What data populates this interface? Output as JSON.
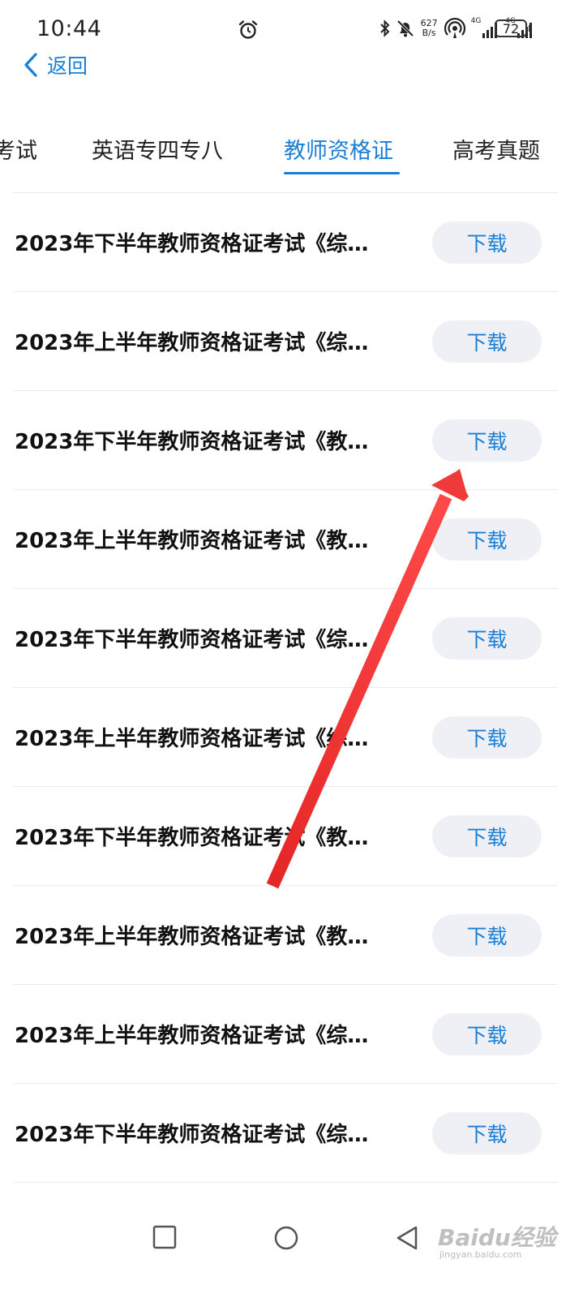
{
  "status_bar": {
    "time": "10:44",
    "net_speed_value": "627",
    "net_speed_unit": "B/s",
    "signal1_label": "4G",
    "signal2_label": "4G",
    "battery": "72"
  },
  "header": {
    "back_label": "返回"
  },
  "tabs": [
    {
      "label": "考试",
      "active": false
    },
    {
      "label": "英语专四专八",
      "active": false
    },
    {
      "label": "教师资格证",
      "active": true
    },
    {
      "label": "高考真题",
      "active": false
    }
  ],
  "list": {
    "items": [
      {
        "title": "2023年下半年教师资格证考试《综…",
        "button": "下载"
      },
      {
        "title": "2023年上半年教师资格证考试《综…",
        "button": "下载"
      },
      {
        "title": "2023年下半年教师资格证考试《教…",
        "button": "下载"
      },
      {
        "title": "2023年上半年教师资格证考试《教…",
        "button": "下载"
      },
      {
        "title": "2023年下半年教师资格证考试《综…",
        "button": "下载"
      },
      {
        "title": "2023年上半年教师资格证考试《综…",
        "button": "下载"
      },
      {
        "title": "2023年下半年教师资格证考试《教…",
        "button": "下载"
      },
      {
        "title": "2023年上半年教师资格证考试《教…",
        "button": "下载"
      },
      {
        "title": "2023年上半年教师资格证考试《综…",
        "button": "下载"
      },
      {
        "title": "2023年下半年教师资格证考试《综…",
        "button": "下载"
      }
    ]
  },
  "watermark": {
    "text": "Baidu经验",
    "sub": "jingyan.baidu.com"
  },
  "colors": {
    "accent": "#1a7fd4",
    "button_bg": "#eef0f5",
    "arrow": "#f03a3a"
  },
  "icons": {
    "back": "chevron-left-icon",
    "alarm": "alarm-clock-icon",
    "bluetooth": "bluetooth-icon",
    "mute": "bell-off-icon",
    "hotspot": "hotspot-icon",
    "nav_recent": "square-icon",
    "nav_home": "circle-icon",
    "nav_back": "triangle-back-icon"
  }
}
